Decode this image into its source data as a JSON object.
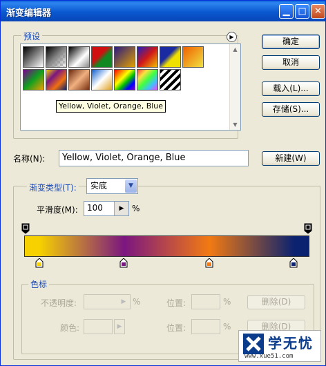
{
  "window": {
    "title": "渐变编辑器"
  },
  "presets": {
    "label": "预设",
    "tooltip": "Yellow, Violet, Orange, Blue"
  },
  "buttons": {
    "ok": "确定",
    "cancel": "取消",
    "load": "载入(L)...",
    "save": "存储(S)...",
    "new": "新建(W)"
  },
  "name": {
    "label": "名称(N):",
    "value": "Yellow, Violet, Orange, Blue"
  },
  "gradient": {
    "type_label": "渐变类型(T):",
    "type_value": "实底",
    "smoothness_label": "平滑度(M):",
    "smoothness_value": "100",
    "percent": "%",
    "colors": [
      "#f7d200",
      "#7b1680",
      "#f27a12",
      "#0a2270"
    ]
  },
  "color_stops": {
    "label": "色标",
    "opacity_label": "不透明度:",
    "opacity_unit": "%",
    "position_label": "位置:",
    "position_unit": "%",
    "delete_label": "删除(D)",
    "color_label": "颜色:",
    "position_label_2": "位置:",
    "position_unit_2": "%",
    "delete_label_2": "删除(D)"
  },
  "watermark": {
    "brand": "学无忧",
    "url": "www.xue51.com"
  }
}
